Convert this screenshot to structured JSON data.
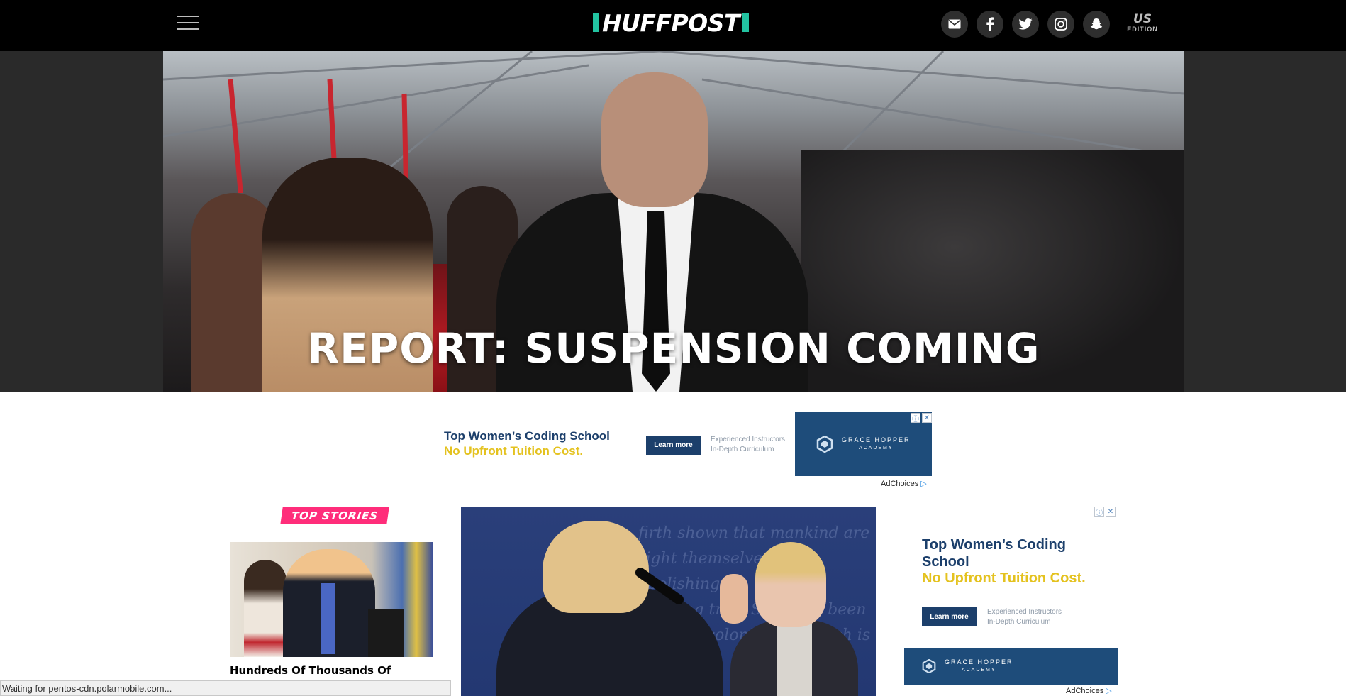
{
  "header": {
    "logo_text": "HUFFPOST",
    "edition_country": "US",
    "edition_label": "EDITION",
    "social": [
      "mail-icon",
      "facebook-icon",
      "twitter-icon",
      "instagram-icon",
      "snapchat-icon"
    ]
  },
  "hero": {
    "title": "REPORT: SUSPENSION COMING"
  },
  "ad_banner": {
    "headline": "Top Women’s Coding School",
    "subheadline": "No Upfront Tuition Cost.",
    "button_label": "Learn more",
    "features": [
      "Experienced Instructors",
      "In-Depth Curriculum"
    ],
    "brand": "GRACE HOPPER",
    "brand_sub": "ACADEMY",
    "adchoices": "AdChoices"
  },
  "top_stories": {
    "label": "TOP STORIES",
    "story1_title": "Hundreds Of Thousands Of Women"
  },
  "side_ad": {
    "headline": "Top Women’s Coding School",
    "subheadline": "No Upfront Tuition Cost.",
    "button_label": "Learn more",
    "features": [
      "Experienced Instructors",
      "In-Depth Curriculum"
    ],
    "brand": "GRACE HOPPER",
    "brand_sub": "ACADEMY",
    "adchoices": "AdChoices"
  },
  "status_bar": {
    "text": "Waiting for pentos-cdn.polarmobile.com..."
  },
  "colors": {
    "accent_green": "#22c3a1",
    "top_stories_pink": "#ff2d7a",
    "ad_navy": "#1c3f6b",
    "ad_yellow": "#e4c21f"
  }
}
